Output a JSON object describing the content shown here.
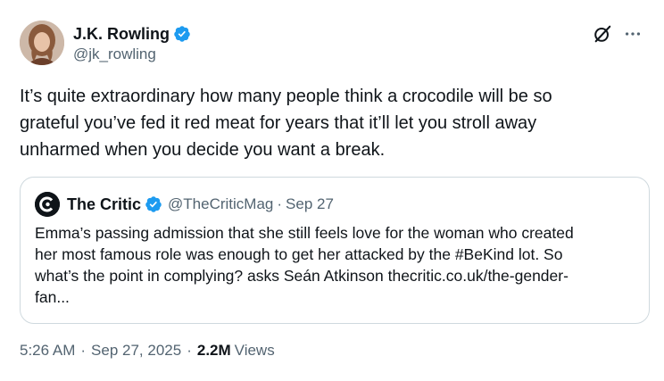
{
  "author": {
    "name": "J.K. Rowling",
    "handle": "@jk_rowling",
    "avatar_icon": "avatar-photo",
    "verified_color": "#1d9bf0"
  },
  "actions": {
    "grok_icon": "grok-icon",
    "more_icon": "more-dots-icon"
  },
  "tweet": {
    "text": "It’s quite extraordinary how many people think a crocodile will be so\ngrateful you’ve fed it red meat for years that it’ll let you stroll away\nunharmed when you decide you want a break."
  },
  "quote": {
    "name": "The Critic",
    "handle": "@TheCriticMag",
    "separator": "·",
    "date": "Sep 27",
    "text": "Emma’s passing admission that she still feels love for the woman who created\nher most famous role was enough to get her attacked by the #BeKind lot. So\nwhat’s the point in complying? asks Seán Atkinson thecritic.co.uk/the-gender-\nfan..."
  },
  "meta": {
    "time": "5:26 AM",
    "separator": "·",
    "date": "Sep 27, 2025",
    "views_count": "2.2M",
    "views_label": "Views"
  },
  "colors": {
    "text": "#0f1419",
    "secondary": "#536471",
    "border": "#cfd9de",
    "verified": "#1d9bf0"
  }
}
